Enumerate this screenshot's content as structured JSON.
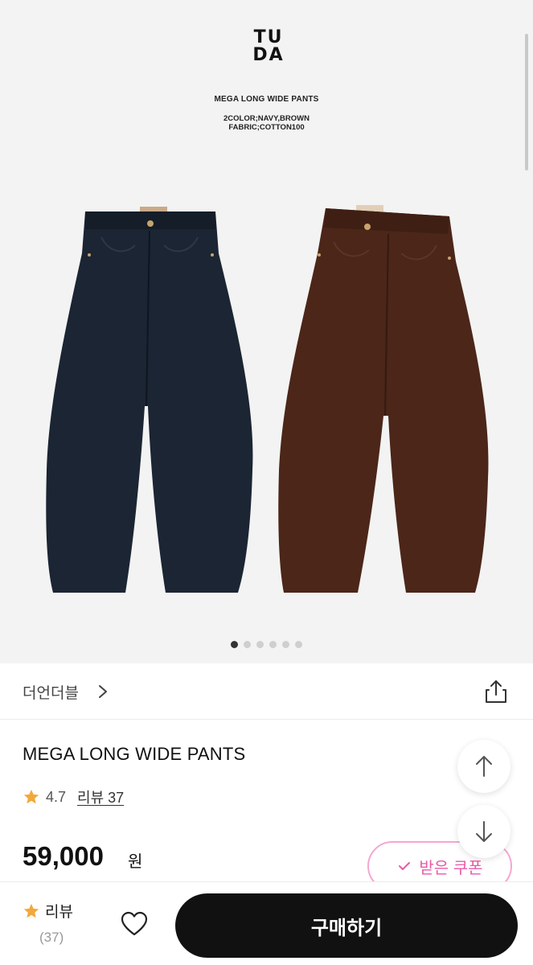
{
  "carousel": {
    "logo_text_line1": "TU",
    "logo_text_line2": "DA",
    "image_title": "MEGA LONG WIDE PANTS",
    "image_spec_line1": "2COLOR;NAVY,BROWN",
    "image_spec_line2": "FABRIC;COTTON100",
    "page_count": 6,
    "active_index": 0
  },
  "seller": {
    "name": "더언더블"
  },
  "product": {
    "name": "MEGA LONG WIDE PANTS",
    "rating": "4.7",
    "review_link": "리뷰 37",
    "price": "59,000",
    "price_unit": "원"
  },
  "coupon": {
    "label": "받은 쿠폰"
  },
  "bottom_bar": {
    "review_label": "리뷰",
    "review_count": "(37)",
    "buy_label": "구매하기"
  },
  "colors": {
    "accent_star": "#f2a93b",
    "coupon_pink": "#e95aa8",
    "buy_button": "#111111"
  }
}
